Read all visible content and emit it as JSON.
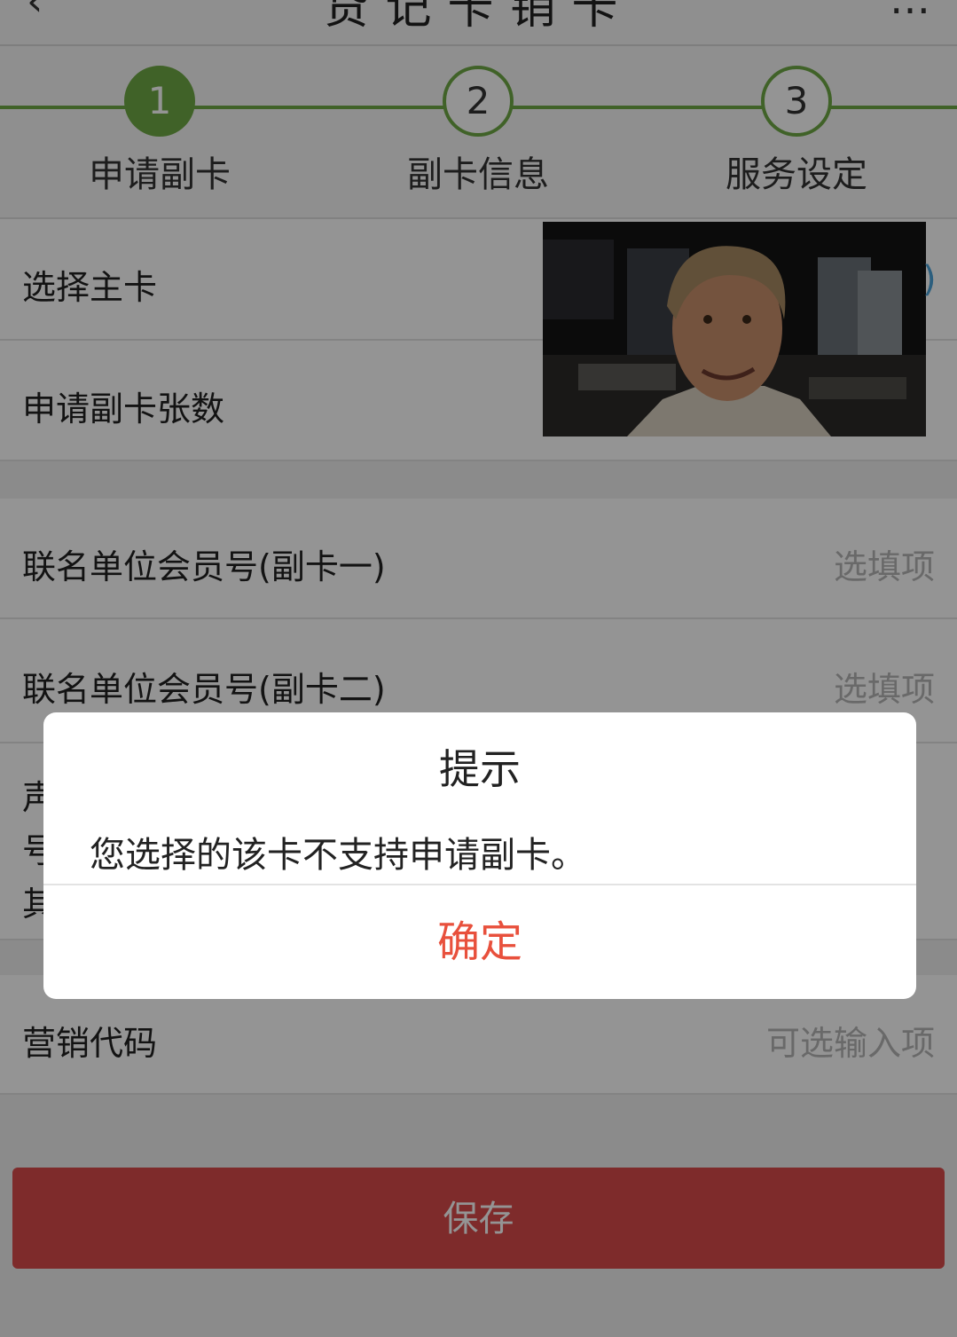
{
  "header": {
    "back": "‹",
    "title": "贷记卡销卡",
    "right": "…"
  },
  "steps": [
    {
      "number": "1",
      "label": "申请副卡"
    },
    {
      "number": "2",
      "label": "副卡信息"
    },
    {
      "number": "3",
      "label": "服务设定"
    }
  ],
  "form": {
    "main_card_label": "选择主卡",
    "card_count_label": "申请副卡张数",
    "member_no_1_label": "联名单位会员号(副卡一)",
    "member_no_1_placeholder": "选填项",
    "member_no_2_label": "联名单位会员号(副卡二)",
    "member_no_2_placeholder": "选填项",
    "declaration_line1": "声",
    "declaration_line2": "号",
    "declaration_line3": "其",
    "marketing_code_label": "营销代码",
    "marketing_code_placeholder": "可选输入项"
  },
  "save_label": "保存",
  "dialog": {
    "title": "提示",
    "message": "您选择的该卡不支持申请副卡。",
    "ok_label": "确定"
  },
  "colors": {
    "step_green": "#6eaa45",
    "save_red": "#d94a4a",
    "ok_text": "#e8503c"
  }
}
